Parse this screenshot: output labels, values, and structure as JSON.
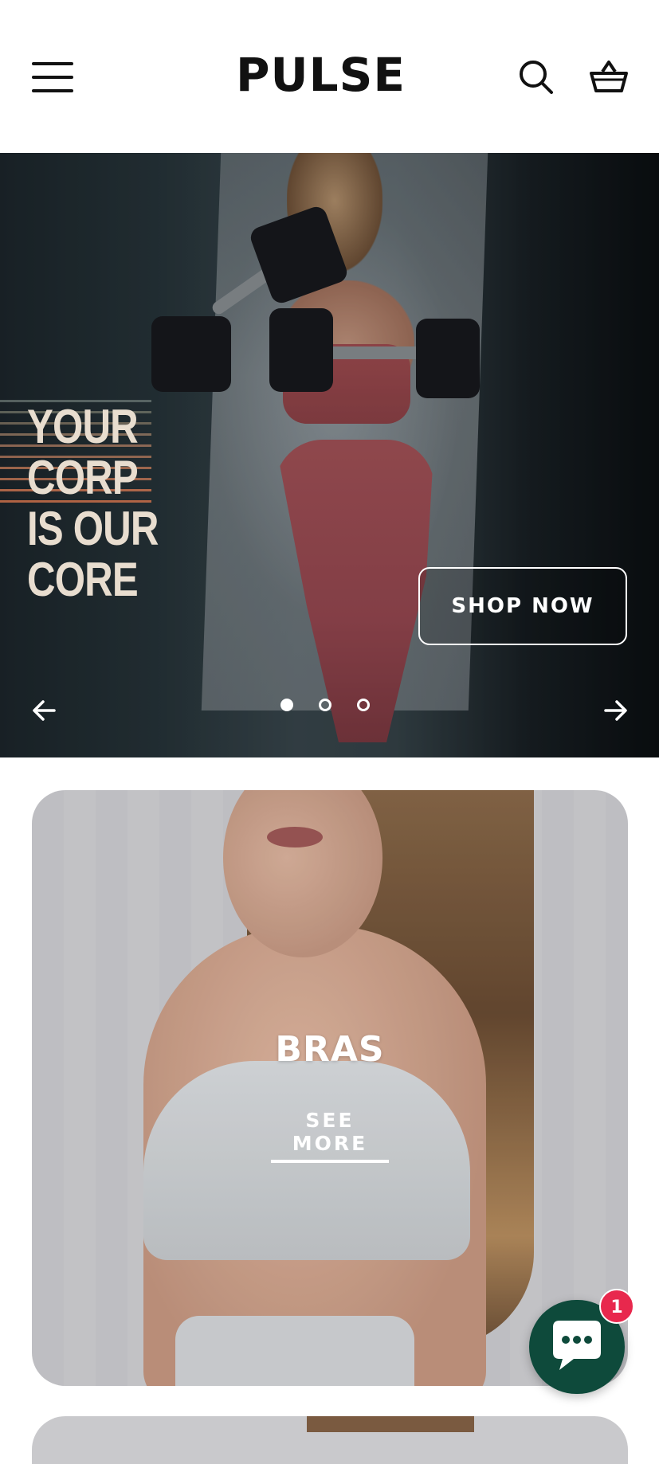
{
  "header": {
    "logo_text": "PULSE",
    "menu_icon": "hamburger-menu-icon",
    "search_icon": "search-icon",
    "cart_icon": "basket-icon"
  },
  "hero": {
    "headline_line1": "YOUR CORP",
    "headline_line2": "IS OUR CORE",
    "cta_label": "SHOP NOW",
    "prev_icon": "arrow-left-icon",
    "next_icon": "arrow-right-icon",
    "slides": {
      "total": 3,
      "active": 1
    }
  },
  "collection": {
    "title": "BRAS",
    "link_label": "SEE MORE"
  },
  "chat": {
    "icon": "chat-bubble-icon",
    "badge_count": "1",
    "accent": "#0e4a3b",
    "badge_color": "#e8284d"
  }
}
